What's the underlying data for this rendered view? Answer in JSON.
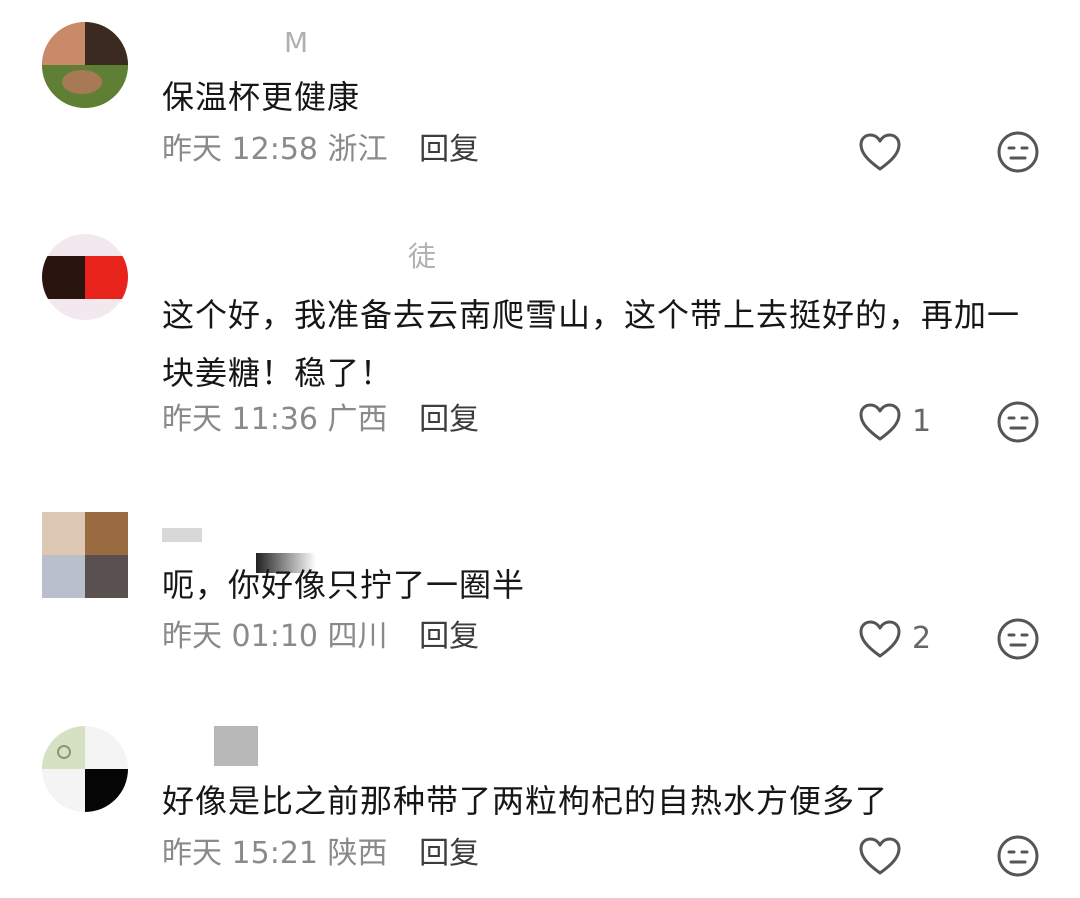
{
  "comments": [
    {
      "username": "M",
      "text": "保温杯更健康",
      "time": "昨天 12:58",
      "location": "浙江",
      "reply_label": "回复",
      "likes": ""
    },
    {
      "username": "徒",
      "text": "这个好，我准备去云南爬雪山，这个带上去挺好的，再加一块姜糖！稳了！",
      "time": "昨天 11:36",
      "location": "广西",
      "reply_label": "回复",
      "likes": "1"
    },
    {
      "username": "",
      "text": "呃，你好像只拧了一圈半",
      "time": "昨天 01:10",
      "location": "四川",
      "reply_label": "回复",
      "likes": "2"
    },
    {
      "username": "",
      "text": "好像是比之前那种带了两粒枸杞的自热水方便多了",
      "time": "昨天 15:21",
      "location": "陕西",
      "reply_label": "回复",
      "likes": ""
    }
  ],
  "icons": {
    "like": "heart-outline-icon",
    "dislike": "neutral-face-icon"
  },
  "colors": {
    "meta_text": "#8a8a8a",
    "icon_stroke": "#555555"
  }
}
